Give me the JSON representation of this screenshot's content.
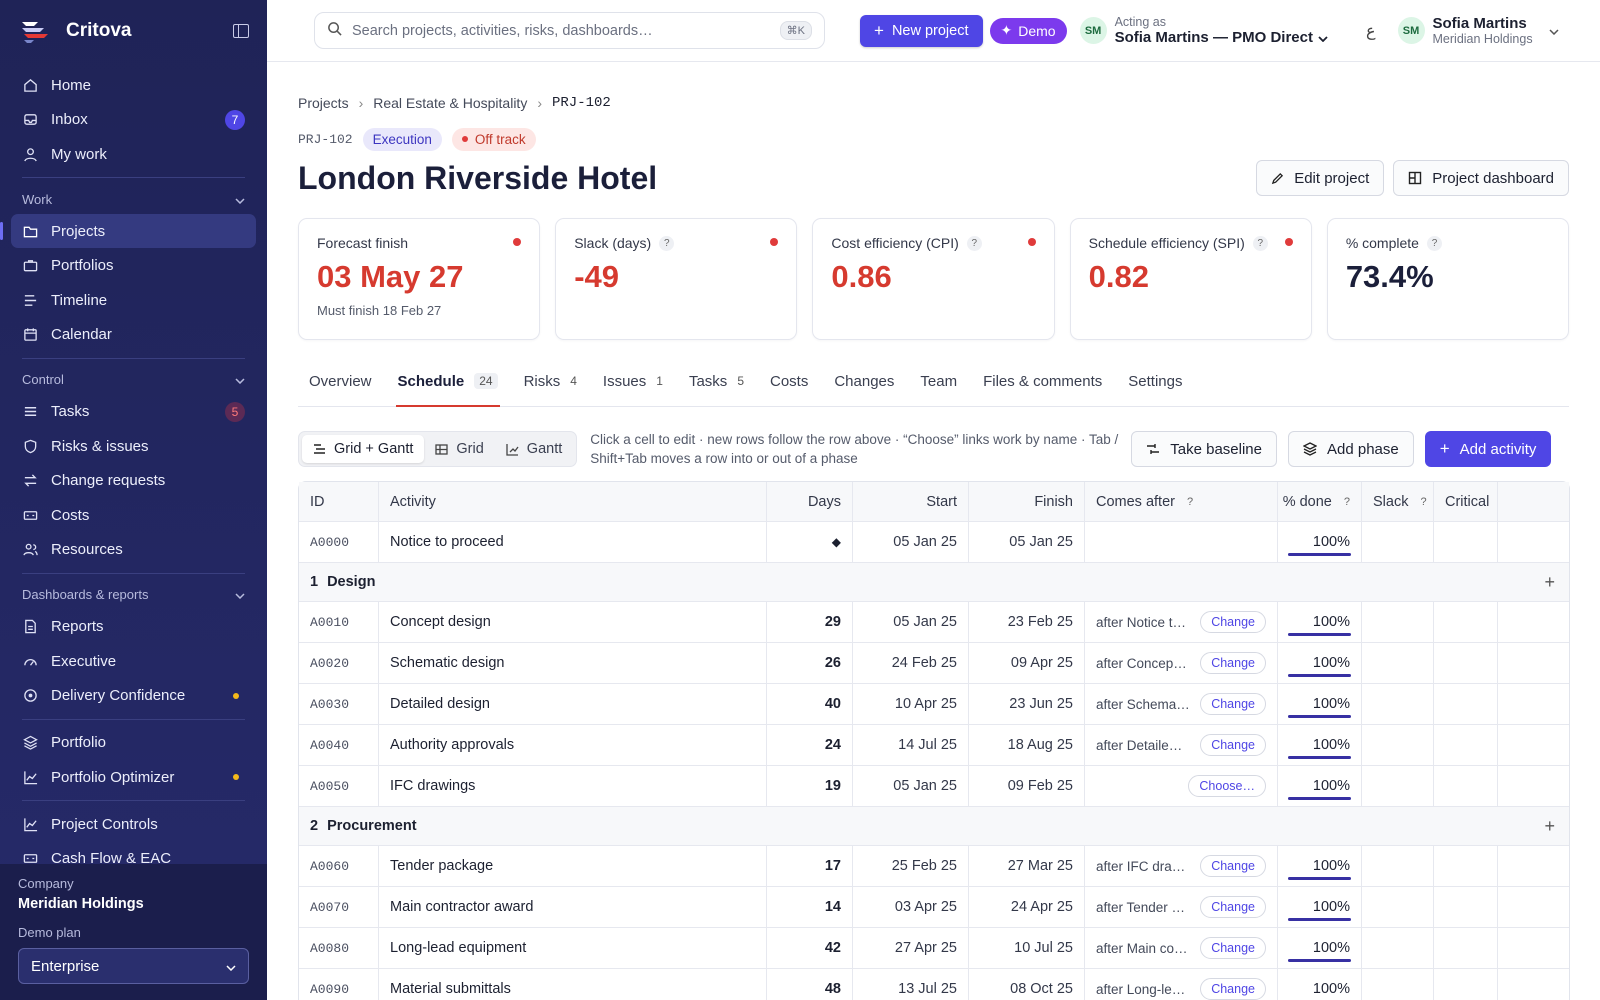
{
  "app": {
    "brand": "Critova"
  },
  "sidebar": {
    "top_items": [
      {
        "label": "Home",
        "icon": "home-icon"
      },
      {
        "label": "Inbox",
        "icon": "inbox-icon",
        "badge": "7"
      },
      {
        "label": "My work",
        "icon": "user-icon"
      }
    ],
    "sections": {
      "work": "Work",
      "control": "Control",
      "dashboards": "Dashboards & reports"
    },
    "work_items": [
      {
        "label": "Projects",
        "icon": "folder-icon",
        "active": true
      },
      {
        "label": "Portfolios",
        "icon": "briefcase-icon"
      },
      {
        "label": "Timeline",
        "icon": "timeline-icon"
      },
      {
        "label": "Calendar",
        "icon": "calendar-icon"
      }
    ],
    "control_items": [
      {
        "label": "Tasks",
        "icon": "list-icon",
        "badge": "5"
      },
      {
        "label": "Risks & issues",
        "icon": "shield-icon"
      },
      {
        "label": "Change requests",
        "icon": "swap-icon"
      },
      {
        "label": "Costs",
        "icon": "money-icon"
      },
      {
        "label": "Resources",
        "icon": "users-icon"
      }
    ],
    "report_items": [
      {
        "label": "Reports",
        "icon": "document-icon"
      },
      {
        "label": "Executive",
        "icon": "gauge-icon"
      },
      {
        "label": "Delivery Confidence",
        "icon": "target-icon",
        "dot": true
      }
    ],
    "extra_items": [
      {
        "label": "Portfolio",
        "icon": "layers-icon"
      },
      {
        "label": "Portfolio Optimizer",
        "icon": "chart-icon",
        "dot": true
      }
    ],
    "extra_items2": [
      {
        "label": "Project Controls",
        "icon": "chart-icon"
      },
      {
        "label": "Cash Flow & EAC",
        "icon": "money-icon"
      }
    ],
    "company_label": "Company",
    "company_value": "Meridian Holdings",
    "plan_label": "Demo plan",
    "plan_value": "Enterprise"
  },
  "topbar": {
    "search_placeholder": "Search projects, activities, risks, dashboards…",
    "search_shortcut": "⌘K",
    "new_project": "New project",
    "demo": "Demo",
    "acting_initials": "SM",
    "acting_label": "Acting as",
    "acting_value": "Sofia Martins — PMO Direct",
    "lang": "ع",
    "user_initials": "SM",
    "user_name": "Sofia Martins",
    "user_org": "Meridian Holdings"
  },
  "breadcrumb": [
    "Projects",
    "Real Estate & Hospitality",
    "PRJ-102"
  ],
  "project": {
    "id": "PRJ-102",
    "phase": "Execution",
    "status": "Off track",
    "title": "London Riverside Hotel",
    "edit": "Edit project",
    "dashboard": "Project dashboard"
  },
  "kpis": [
    {
      "label": "Forecast finish",
      "value": "03 May 27",
      "sub": "Must finish 18 Feb 27",
      "red": true,
      "help": false,
      "alert": true
    },
    {
      "label": "Slack (days)",
      "value": "-49",
      "sub": "",
      "red": true,
      "help": true,
      "alert": true
    },
    {
      "label": "Cost efficiency (CPI)",
      "value": "0.86",
      "sub": "",
      "red": true,
      "help": true,
      "alert": true
    },
    {
      "label": "Schedule efficiency (SPI)",
      "value": "0.82",
      "sub": "",
      "red": true,
      "help": true,
      "alert": true
    },
    {
      "label": "% complete",
      "value": "73.4%",
      "sub": "",
      "red": false,
      "help": true,
      "alert": false
    }
  ],
  "tabs": [
    {
      "label": "Overview",
      "count": ""
    },
    {
      "label": "Schedule",
      "count": "24",
      "active": true
    },
    {
      "label": "Risks",
      "count": "4"
    },
    {
      "label": "Issues",
      "count": "1"
    },
    {
      "label": "Tasks",
      "count": "5"
    },
    {
      "label": "Costs",
      "count": ""
    },
    {
      "label": "Changes",
      "count": ""
    },
    {
      "label": "Team",
      "count": ""
    },
    {
      "label": "Files & comments",
      "count": ""
    },
    {
      "label": "Settings",
      "count": ""
    }
  ],
  "toolbar": {
    "views": [
      "Grid + Gantt",
      "Grid",
      "Gantt"
    ],
    "hint": "Click a cell to edit · new rows follow the row above · “Choose” links work by name · Tab / Shift+Tab moves a row into or out of a phase",
    "baseline": "Take baseline",
    "add_phase": "Add phase",
    "add_activity": "Add activity"
  },
  "grid": {
    "headers": [
      "ID",
      "Activity",
      "Days",
      "Start",
      "Finish",
      "Comes after",
      "% done",
      "Slack",
      "Critical"
    ],
    "rows": [
      {
        "type": "act",
        "id": "A0000",
        "name": "Notice to proceed",
        "days": "◆",
        "start": "05 Jan 25",
        "finish": "05 Jan 25",
        "after": "",
        "link": "",
        "done": "100%",
        "pct": 1
      },
      {
        "type": "phase",
        "num": "1",
        "name": "Design"
      },
      {
        "type": "act",
        "id": "A0010",
        "name": "Concept design",
        "days": "29",
        "start": "05 Jan 25",
        "finish": "23 Feb 25",
        "after": "after Notice t…",
        "link": "Change",
        "done": "100%",
        "pct": 1
      },
      {
        "type": "act",
        "id": "A0020",
        "name": "Schematic design",
        "days": "26",
        "start": "24 Feb 25",
        "finish": "09 Apr 25",
        "after": "after Concep…",
        "link": "Change",
        "done": "100%",
        "pct": 1
      },
      {
        "type": "act",
        "id": "A0030",
        "name": "Detailed design",
        "days": "40",
        "start": "10 Apr 25",
        "finish": "23 Jun 25",
        "after": "after Schema…",
        "link": "Change",
        "done": "100%",
        "pct": 1
      },
      {
        "type": "act",
        "id": "A0040",
        "name": "Authority approvals",
        "days": "24",
        "start": "14 Jul 25",
        "finish": "18 Aug 25",
        "after": "after Detaile…",
        "link": "Change",
        "done": "100%",
        "pct": 1
      },
      {
        "type": "act",
        "id": "A0050",
        "name": "IFC drawings",
        "days": "19",
        "start": "05 Jan 25",
        "finish": "09 Feb 25",
        "after": "",
        "link": "Choose…",
        "done": "100%",
        "pct": 1
      },
      {
        "type": "phase",
        "num": "2",
        "name": "Procurement"
      },
      {
        "type": "act",
        "id": "A0060",
        "name": "Tender package",
        "days": "17",
        "start": "25 Feb 25",
        "finish": "27 Mar 25",
        "after": "after IFC dra…",
        "link": "Change",
        "done": "100%",
        "pct": 1
      },
      {
        "type": "act",
        "id": "A0070",
        "name": "Main contractor award",
        "days": "14",
        "start": "03 Apr 25",
        "finish": "24 Apr 25",
        "after": "after Tender …",
        "link": "Change",
        "done": "100%",
        "pct": 1
      },
      {
        "type": "act",
        "id": "A0080",
        "name": "Long-lead equipment",
        "days": "42",
        "start": "27 Apr 25",
        "finish": "10 Jul 25",
        "after": "after Main co…",
        "link": "Change",
        "done": "100%",
        "pct": 1
      },
      {
        "type": "act",
        "id": "A0090",
        "name": "Material submittals",
        "days": "48",
        "start": "13 Jul 25",
        "finish": "08 Oct 25",
        "after": "after Long-le…",
        "link": "Change",
        "done": "100%",
        "pct": 1
      }
    ]
  },
  "colors": {
    "accent": "#4f46e5",
    "danger": "#d63a2f",
    "sidebar": "#1f2357"
  }
}
